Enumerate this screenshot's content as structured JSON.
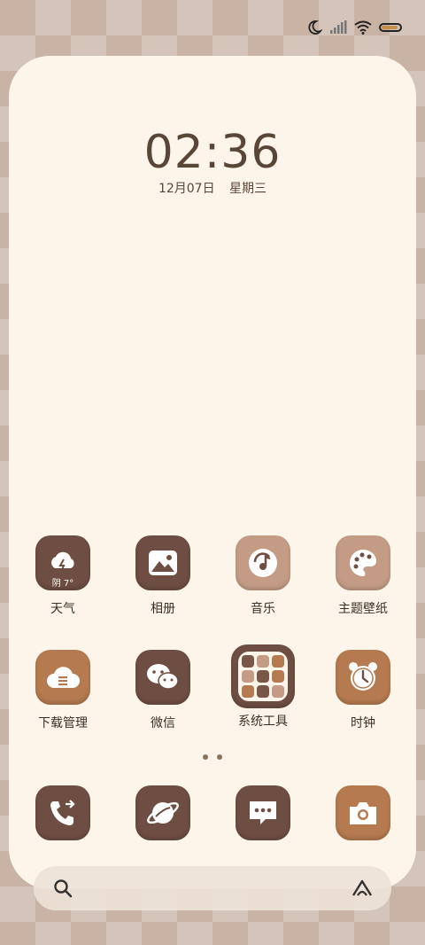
{
  "clock": {
    "time": "02:36",
    "date": "12月07日",
    "weekday": "星期三"
  },
  "status": {
    "icons": [
      "moon-icon",
      "signal-icon",
      "wifi-icon",
      "battery-icon"
    ]
  },
  "apps_row1": [
    {
      "label": "天气",
      "sub": "阴 7°",
      "icon": "weather-icon"
    },
    {
      "label": "相册",
      "icon": "gallery-icon"
    },
    {
      "label": "音乐",
      "icon": "music-icon"
    },
    {
      "label": "主题壁纸",
      "icon": "palette-icon"
    }
  ],
  "apps_row2": [
    {
      "label": "下载管理",
      "icon": "download-icon"
    },
    {
      "label": "微信",
      "icon": "wechat-icon"
    },
    {
      "label": "系统工具",
      "icon": "folder-icon"
    },
    {
      "label": "时钟",
      "icon": "alarm-clock-icon"
    }
  ],
  "dock": [
    {
      "icon": "phone-icon"
    },
    {
      "icon": "browser-icon"
    },
    {
      "icon": "messages-icon"
    },
    {
      "icon": "camera-icon"
    }
  ],
  "colors": {
    "dark": "#6e4e42",
    "light": "#c49c85",
    "warm": "#b57a4f",
    "card": "#fdf4ea"
  }
}
